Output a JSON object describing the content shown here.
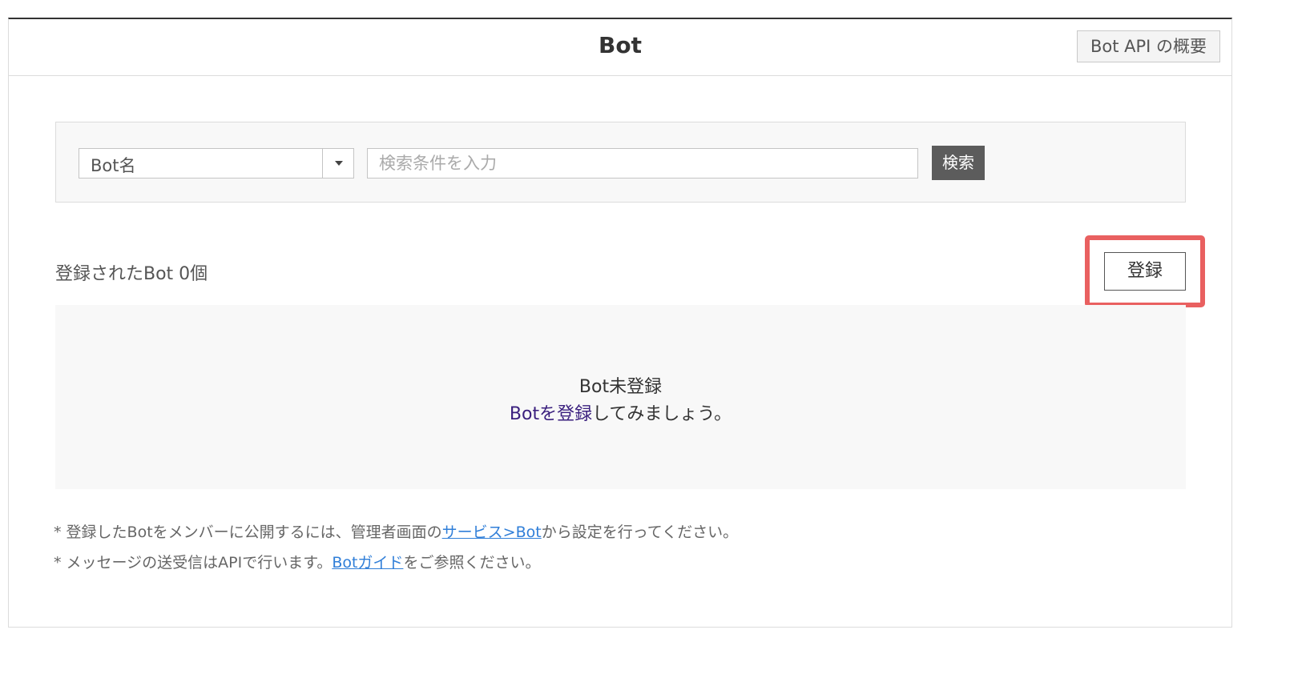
{
  "header": {
    "title": "Bot",
    "api_overview_label": "Bot API の概要"
  },
  "search": {
    "select_value": "Bot名",
    "placeholder": "検索条件を入力",
    "button_label": "検索"
  },
  "list": {
    "count_label": "登録されたBot 0個",
    "register_label": "登録"
  },
  "empty_state": {
    "title": "Bot未登録",
    "link_text": "Botを登録",
    "suffix_text": "してみましょう。"
  },
  "notes": [
    {
      "prefix": "* 登録したBotをメンバーに公開するには、管理者画面の",
      "link": "サービス>Bot",
      "suffix": "から設定を行ってください。"
    },
    {
      "prefix": "* メッセージの送受信はAPIで行います。",
      "link": "Botガイド",
      "suffix": "をご参照ください。"
    }
  ],
  "colors": {
    "highlight": "#e96060",
    "link": "#2f7ed8",
    "visited_link": "#3a1f7e",
    "search_button": "#5c5c5c"
  }
}
